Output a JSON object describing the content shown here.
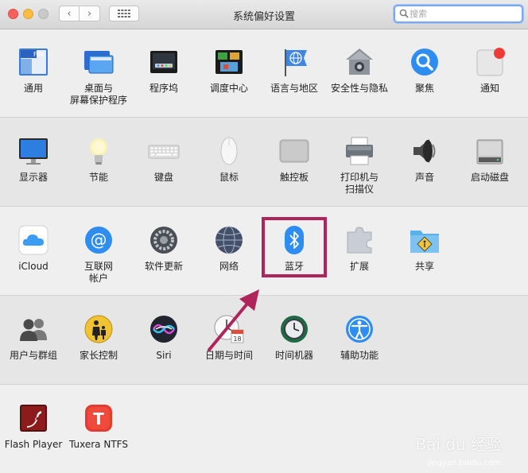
{
  "window": {
    "title": "系统偏好设置"
  },
  "search": {
    "placeholder": "搜索"
  },
  "toolbar": {
    "back": "‹",
    "forward": "›"
  },
  "rows": [
    {
      "items": [
        {
          "label": "通用",
          "icon": "general-icon"
        },
        {
          "label": "桌面与\n屏幕保护程序",
          "icon": "desktop-screensaver-icon"
        },
        {
          "label": "程序坞",
          "icon": "dock-icon"
        },
        {
          "label": "调度中心",
          "icon": "mission-control-icon"
        },
        {
          "label": "语言与地区",
          "icon": "language-region-icon"
        },
        {
          "label": "安全性与隐私",
          "icon": "security-privacy-icon"
        },
        {
          "label": "聚焦",
          "icon": "spotlight-icon"
        },
        {
          "label": "通知",
          "icon": "notifications-icon"
        }
      ]
    },
    {
      "items": [
        {
          "label": "显示器",
          "icon": "displays-icon"
        },
        {
          "label": "节能",
          "icon": "energy-saver-icon"
        },
        {
          "label": "键盘",
          "icon": "keyboard-icon"
        },
        {
          "label": "鼠标",
          "icon": "mouse-icon"
        },
        {
          "label": "触控板",
          "icon": "trackpad-icon"
        },
        {
          "label": "打印机与\n扫描仪",
          "icon": "printers-scanners-icon"
        },
        {
          "label": "声音",
          "icon": "sound-icon"
        },
        {
          "label": "启动磁盘",
          "icon": "startup-disk-icon"
        }
      ]
    },
    {
      "items": [
        {
          "label": "iCloud",
          "icon": "icloud-icon"
        },
        {
          "label": "互联网\n帐户",
          "icon": "internet-accounts-icon"
        },
        {
          "label": "软件更新",
          "icon": "software-update-icon"
        },
        {
          "label": "网络",
          "icon": "network-icon"
        },
        {
          "label": "蓝牙",
          "icon": "bluetooth-icon"
        },
        {
          "label": "扩展",
          "icon": "extensions-icon"
        },
        {
          "label": "共享",
          "icon": "sharing-icon"
        }
      ]
    },
    {
      "items": [
        {
          "label": "用户与群组",
          "icon": "users-groups-icon"
        },
        {
          "label": "家长控制",
          "icon": "parental-controls-icon"
        },
        {
          "label": "Siri",
          "icon": "siri-icon"
        },
        {
          "label": "日期与时间",
          "icon": "date-time-icon"
        },
        {
          "label": "时间机器",
          "icon": "time-machine-icon"
        },
        {
          "label": "辅助功能",
          "icon": "accessibility-icon"
        }
      ]
    },
    {
      "items": [
        {
          "label": "Flash Player",
          "icon": "flash-player-icon"
        },
        {
          "label": "Tuxera NTFS",
          "icon": "tuxera-ntfs-icon"
        }
      ]
    }
  ],
  "annotation": {
    "highlighted_item": "蓝牙",
    "color": "#b0245c"
  },
  "watermark": {
    "text": "Bai du 经验",
    "sub": "jingyan.baidu.com"
  },
  "colors": {
    "accent": "#1b8af5",
    "highlight_border": "#b0245c"
  }
}
